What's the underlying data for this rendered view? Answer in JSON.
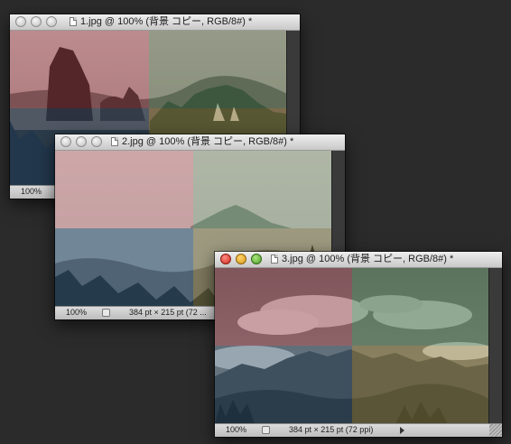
{
  "windows": [
    {
      "id": "1",
      "title": "1.jpg @ 100% (背景 コピー, RGB/8#) *",
      "active": false,
      "status": {
        "zoom": "100%",
        "info": ""
      }
    },
    {
      "id": "2",
      "title": "2.jpg @ 100% (背景 コピー, RGB/8#) *",
      "active": false,
      "status": {
        "zoom": "100%",
        "info": "384 pt × 215 pt (72 ..."
      }
    },
    {
      "id": "3",
      "title": "3.jpg @ 100% (背景 コピー, RGB/8#) *",
      "active": true,
      "status": {
        "zoom": "100%",
        "info": "384 pt × 215 pt (72 ppi)"
      }
    }
  ],
  "colors": {
    "desktop": "#2b2b2b",
    "tint_red": "#9c3b47",
    "tint_green": "#4e7a52",
    "tint_blue": "#2d4f6e",
    "tint_yellow": "#8c7a3a"
  }
}
